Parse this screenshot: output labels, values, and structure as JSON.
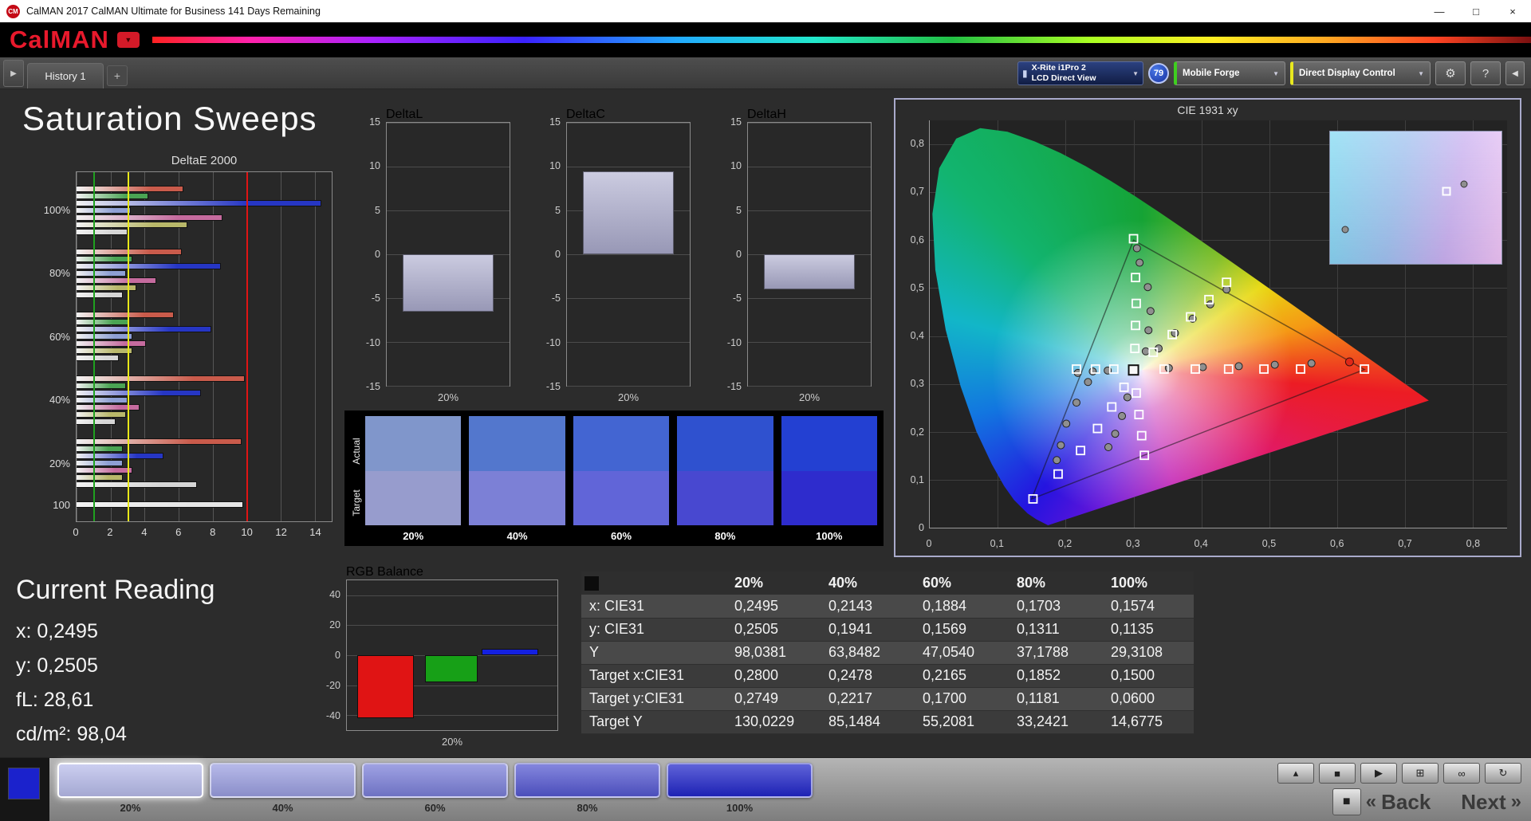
{
  "titlebar": {
    "title": "CalMAN 2017 CalMAN Ultimate for Business 141 Days Remaining"
  },
  "logo": {
    "text": "CalMAN"
  },
  "tabbar": {
    "tab": "History 1",
    "add": "+"
  },
  "toolbar": {
    "meter_line1": "X-Rite i1Pro 2",
    "meter_line2": "LCD Direct View",
    "meter_badge": "79",
    "source_label": "Mobile Forge",
    "display_label": "Direct Display Control"
  },
  "icons": {
    "app": "CM",
    "dropdown": "▼",
    "minimize": "—",
    "maximize": "□",
    "close": "×",
    "panel_toggle": "▶",
    "meter": "▮",
    "gear": "⚙",
    "help": "?",
    "collapse_right": "◀",
    "eject": "▴",
    "stop": "■",
    "play": "▶",
    "window": "⊞",
    "infinity": "∞",
    "loop": "↻",
    "big_stop": "■",
    "back_chevron": "«",
    "next_chevron": "»"
  },
  "page_title": "Saturation Sweeps",
  "deltae": {
    "title": "DeltaE 2000",
    "xticks": [
      0,
      2,
      4,
      6,
      8,
      10,
      12,
      14
    ],
    "xmax": 15,
    "bar_colors": [
      "#c95b4b",
      "#4aa353",
      "#2636c4",
      "#8e9fd4",
      "#c56b9e",
      "#b9b86a",
      "#d6d6d6"
    ],
    "ref_lines": [
      {
        "x": 1,
        "color": "#1fa01f"
      },
      {
        "x": 3,
        "color": "#e8e818"
      },
      {
        "x": 10,
        "color": "#e01414"
      }
    ],
    "groups": [
      {
        "label": "100%",
        "values": [
          6.3,
          4.2,
          14.4,
          3.2,
          8.6,
          6.5,
          3.0
        ]
      },
      {
        "label": "80%",
        "values": [
          6.2,
          3.3,
          8.5,
          2.9,
          4.7,
          3.5,
          2.7
        ]
      },
      {
        "label": "60%",
        "values": [
          5.7,
          3.1,
          7.9,
          3.3,
          4.1,
          3.3,
          2.5
        ]
      },
      {
        "label": "40%",
        "values": [
          9.9,
          2.9,
          7.3,
          3.0,
          3.7,
          2.9,
          2.3
        ]
      },
      {
        "label": "20%",
        "values": [
          9.7,
          2.7,
          5.1,
          2.7,
          3.3,
          2.7,
          7.1
        ]
      },
      {
        "label": "100",
        "values": [
          9.8
        ],
        "colors": [
          "#e6e6e6"
        ]
      }
    ]
  },
  "delta_axis": {
    "min": -15,
    "max": 15,
    "ticks": [
      15,
      10,
      5,
      0,
      -5,
      -10,
      -15
    ]
  },
  "delta_charts": [
    {
      "title": "DeltaL",
      "value": -6.5,
      "label": "20%"
    },
    {
      "title": "DeltaC",
      "value": 9.5,
      "label": "20%"
    },
    {
      "title": "DeltaH",
      "value": -4.0,
      "label": "20%"
    }
  ],
  "swatches": {
    "row_labels": [
      "Actual",
      "Target"
    ],
    "columns": [
      "20%",
      "40%",
      "60%",
      "80%",
      "100%"
    ],
    "actual": [
      "#8096cb",
      "#5377cd",
      "#4365d2",
      "#2f51cf",
      "#2340d2"
    ],
    "target": [
      "#979ccd",
      "#7c80d6",
      "#6165d8",
      "#4848d0",
      "#2e2ccd"
    ]
  },
  "cie": {
    "title": "CIE 1931 xy",
    "axis_max": 0.85,
    "ticks": [
      {
        "value": 0.0,
        "label": "0"
      },
      {
        "value": 0.1,
        "label": "0,1"
      },
      {
        "value": 0.2,
        "label": "0,2"
      },
      {
        "value": 0.3,
        "label": "0,3"
      },
      {
        "value": 0.4,
        "label": "0,4"
      },
      {
        "value": 0.5,
        "label": "0,5"
      },
      {
        "value": 0.6,
        "label": "0,6"
      },
      {
        "value": 0.7,
        "label": "0,7"
      },
      {
        "value": 0.8,
        "label": "0,8"
      }
    ],
    "locus": [
      [
        0.1741,
        0.005
      ],
      [
        0.1566,
        0.0177
      ],
      [
        0.144,
        0.0297
      ],
      [
        0.1241,
        0.0578
      ],
      [
        0.1096,
        0.0868
      ],
      [
        0.0913,
        0.1327
      ],
      [
        0.0687,
        0.2007
      ],
      [
        0.0454,
        0.295
      ],
      [
        0.0235,
        0.4127
      ],
      [
        0.0082,
        0.5384
      ],
      [
        0.0039,
        0.6548
      ],
      [
        0.0139,
        0.7502
      ],
      [
        0.0389,
        0.812
      ],
      [
        0.0743,
        0.8338
      ],
      [
        0.1142,
        0.8262
      ],
      [
        0.1547,
        0.8059
      ],
      [
        0.1929,
        0.7816
      ],
      [
        0.2296,
        0.7543
      ],
      [
        0.2658,
        0.7243
      ],
      [
        0.3016,
        0.6923
      ],
      [
        0.3373,
        0.6589
      ],
      [
        0.3731,
        0.6245
      ],
      [
        0.4087,
        0.5896
      ],
      [
        0.4441,
        0.5547
      ],
      [
        0.4788,
        0.5202
      ],
      [
        0.5125,
        0.4866
      ],
      [
        0.5448,
        0.4544
      ],
      [
        0.5752,
        0.4242
      ],
      [
        0.6029,
        0.3965
      ],
      [
        0.627,
        0.3725
      ],
      [
        0.6482,
        0.3514
      ],
      [
        0.6658,
        0.334
      ],
      [
        0.6915,
        0.3083
      ],
      [
        0.714,
        0.2859
      ],
      [
        0.7347,
        0.2653
      ]
    ],
    "gamut_triangle": [
      [
        0.64,
        0.33
      ],
      [
        0.3,
        0.6
      ],
      [
        0.15,
        0.06
      ]
    ],
    "white_point": [
      0.3,
      0.329
    ],
    "red_point": [
      0.618,
      0.346
    ],
    "targets": [
      [
        0.345,
        0.331
      ],
      [
        0.391,
        0.331
      ],
      [
        0.44,
        0.331
      ],
      [
        0.492,
        0.331
      ],
      [
        0.546,
        0.331
      ],
      [
        0.64,
        0.331
      ],
      [
        0.302,
        0.374
      ],
      [
        0.303,
        0.422
      ],
      [
        0.304,
        0.468
      ],
      [
        0.303,
        0.522
      ],
      [
        0.3,
        0.603
      ],
      [
        0.286,
        0.293
      ],
      [
        0.268,
        0.252
      ],
      [
        0.247,
        0.207
      ],
      [
        0.222,
        0.161
      ],
      [
        0.189,
        0.112
      ],
      [
        0.152,
        0.06
      ],
      [
        0.304,
        0.281
      ],
      [
        0.308,
        0.236
      ],
      [
        0.312,
        0.192
      ],
      [
        0.316,
        0.151
      ],
      [
        0.329,
        0.366
      ],
      [
        0.357,
        0.403
      ],
      [
        0.384,
        0.44
      ],
      [
        0.411,
        0.476
      ],
      [
        0.437,
        0.512
      ],
      [
        0.271,
        0.331
      ],
      [
        0.244,
        0.331
      ],
      [
        0.216,
        0.331
      ]
    ],
    "measurements": [
      [
        0.352,
        0.333
      ],
      [
        0.402,
        0.335
      ],
      [
        0.455,
        0.337
      ],
      [
        0.508,
        0.34
      ],
      [
        0.562,
        0.343
      ],
      [
        0.318,
        0.368
      ],
      [
        0.322,
        0.412
      ],
      [
        0.325,
        0.452
      ],
      [
        0.321,
        0.502
      ],
      [
        0.309,
        0.553
      ],
      [
        0.305,
        0.583
      ],
      [
        0.233,
        0.304
      ],
      [
        0.216,
        0.261
      ],
      [
        0.201,
        0.217
      ],
      [
        0.193,
        0.172
      ],
      [
        0.187,
        0.141
      ],
      [
        0.291,
        0.272
      ],
      [
        0.283,
        0.233
      ],
      [
        0.273,
        0.196
      ],
      [
        0.263,
        0.168
      ],
      [
        0.337,
        0.374
      ],
      [
        0.361,
        0.406
      ],
      [
        0.387,
        0.436
      ],
      [
        0.413,
        0.466
      ],
      [
        0.437,
        0.497
      ],
      [
        0.262,
        0.328
      ],
      [
        0.24,
        0.326
      ],
      [
        0.218,
        0.323
      ]
    ],
    "inset": {
      "targets": [
        [
          68,
          45
        ]
      ],
      "measurements": [
        [
          78,
          40
        ],
        [
          9,
          74
        ]
      ]
    }
  },
  "current_reading": {
    "title": "Current Reading",
    "lines": [
      "x: 0,2495",
      "y: 0,2505",
      "fL: 28,61",
      "cd/m²: 98,04"
    ]
  },
  "rgb_balance": {
    "title": "RGB Balance",
    "label": "20%",
    "axis_max": 50,
    "axis_min": -50,
    "yticks": [
      40,
      20,
      0,
      -20,
      -40
    ],
    "values": {
      "red": -42,
      "green": -18,
      "blue": 4
    },
    "colors": {
      "red": "#e01414",
      "green": "#17a017",
      "blue": "#1420e0"
    }
  },
  "table": {
    "columns": [
      "20%",
      "40%",
      "60%",
      "80%",
      "100%"
    ],
    "rows": [
      {
        "label": "x: CIE31",
        "values": [
          "0,2495",
          "0,2143",
          "0,1884",
          "0,1703",
          "0,1574"
        ]
      },
      {
        "label": "y: CIE31",
        "values": [
          "0,2505",
          "0,1941",
          "0,1569",
          "0,1311",
          "0,1135"
        ]
      },
      {
        "label": "Y",
        "values": [
          "98,0381",
          "63,8482",
          "47,0540",
          "37,1788",
          "29,3108"
        ]
      },
      {
        "label": "Target x:CIE31",
        "values": [
          "0,2800",
          "0,2478",
          "0,2165",
          "0,1852",
          "0,1500"
        ]
      },
      {
        "label": "Target y:CIE31",
        "values": [
          "0,2749",
          "0,2217",
          "0,1700",
          "0,1181",
          "0,0600"
        ]
      },
      {
        "label": "Target Y",
        "values": [
          "130,0229",
          "85,1484",
          "55,2081",
          "33,2421",
          "14,6775"
        ]
      }
    ]
  },
  "bottombar": {
    "current_patch_color": "#1b22cc",
    "patches": [
      {
        "label": "20%",
        "color": "#b7bbea",
        "selected": true
      },
      {
        "label": "40%",
        "color": "#9a9ee0",
        "selected": false
      },
      {
        "label": "60%",
        "color": "#7a7ed8",
        "selected": false
      },
      {
        "label": "80%",
        "color": "#5457d0",
        "selected": false
      },
      {
        "label": "100%",
        "color": "#2126c9",
        "selected": false
      }
    ],
    "back": "Back",
    "next": "Next"
  }
}
